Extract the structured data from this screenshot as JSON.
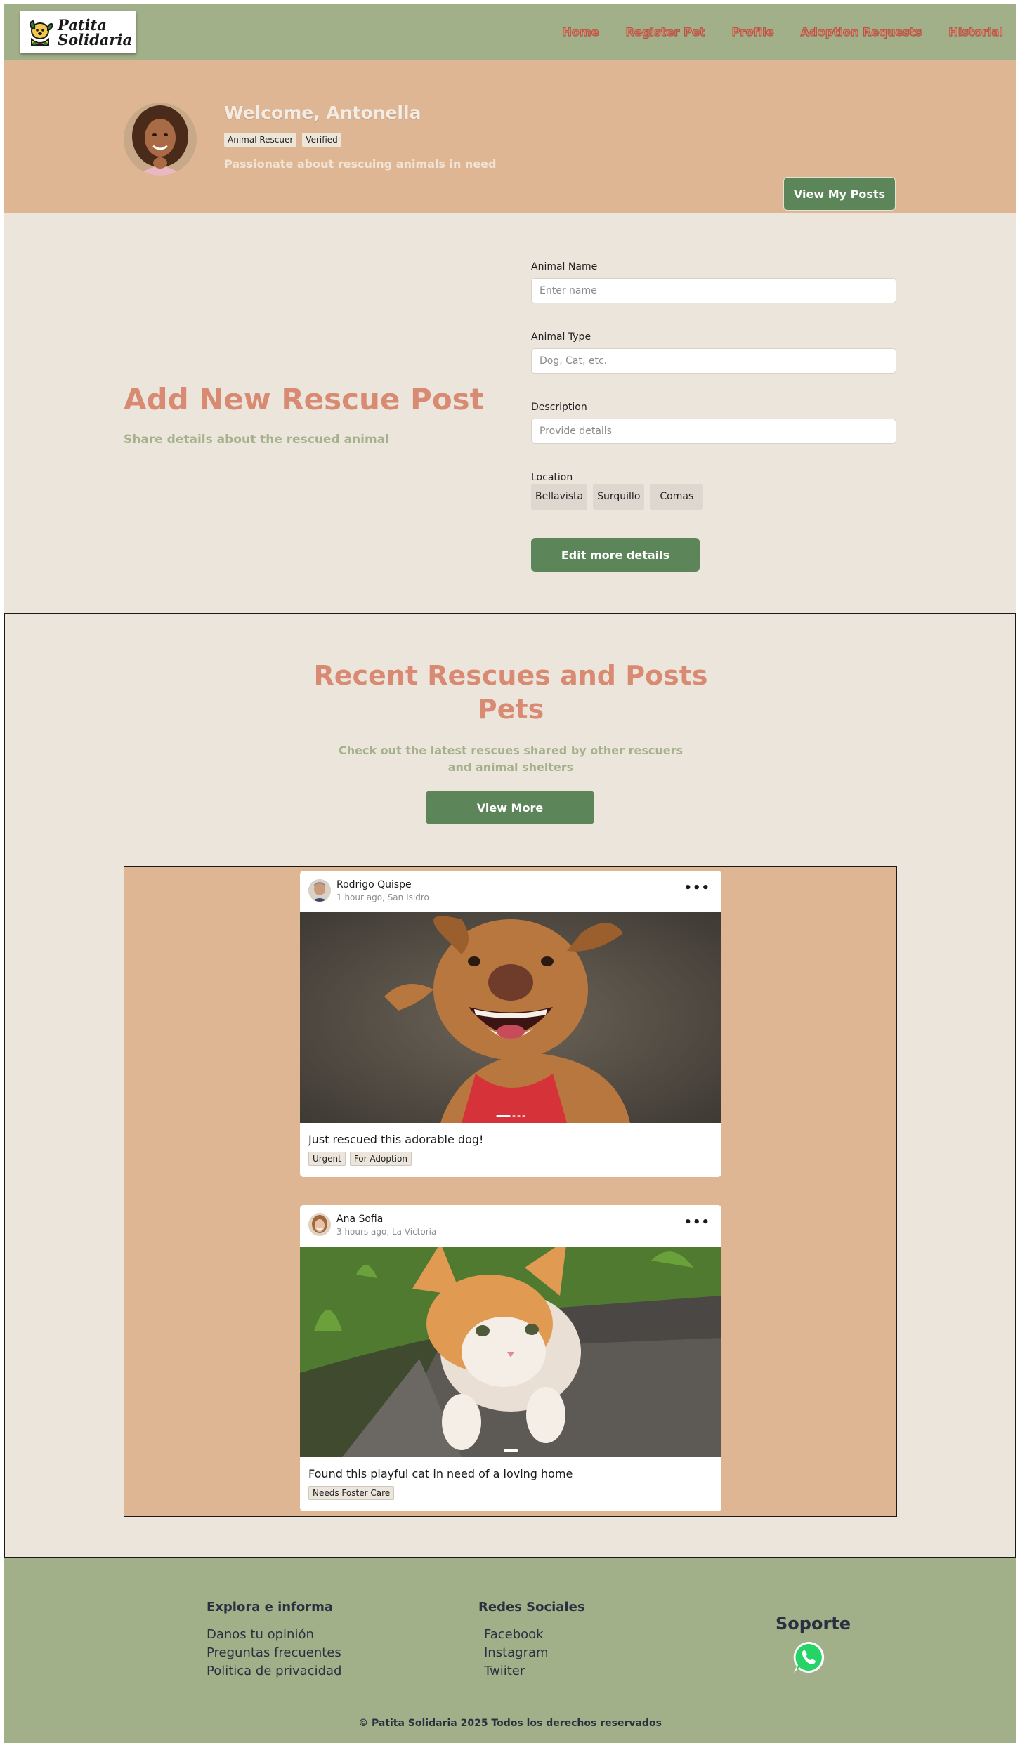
{
  "brand": {
    "name_line1": "Patita",
    "name_line2": "Solidaria"
  },
  "nav": {
    "items": [
      "Home",
      "Register Pet",
      "Profile",
      "Adoption Requests",
      "Historial"
    ]
  },
  "welcome": {
    "title": "Welcome, Antonella",
    "badges": [
      "Animal Rescuer",
      "Verified"
    ],
    "subtitle": "Passionate about rescuing animals in need",
    "button": "View My Posts"
  },
  "add_post": {
    "title": "Add New Rescue Post",
    "subtitle": "Share details about the rescued animal",
    "fields": [
      {
        "label": "Animal Name",
        "placeholder": "Enter name"
      },
      {
        "label": "Animal Type",
        "placeholder": "Dog, Cat, etc."
      },
      {
        "label": "Description",
        "placeholder": "Provide details"
      }
    ],
    "location_label": "Location",
    "locations": [
      "Bellavista",
      "Surquillo",
      "Comas"
    ],
    "button": "Edit more details"
  },
  "recent": {
    "title": "Recent Rescues and Posts Pets",
    "subtitle": "Check out the latest rescues shared by other rescuers and animal shelters",
    "button": "View More"
  },
  "posts": [
    {
      "author": "Rodrigo Quispe",
      "meta": "1 hour ago, San Isidro",
      "caption": "Just rescued this adorable dog!",
      "tags": [
        "Urgent",
        "For Adoption"
      ],
      "image": "dog-photo",
      "slides": 4
    },
    {
      "author": "Ana Sofia",
      "meta": "3 hours ago, La Victoria",
      "caption": "Found this playful cat in need of a loving home",
      "tags": [
        "Needs Foster Care"
      ],
      "image": "kitten-photo",
      "slides": 1
    }
  ],
  "footer": {
    "col1": {
      "heading": "Explora e informa",
      "links": [
        "Danos tu opinión",
        "Preguntas frecuentes",
        "Politica de privacidad"
      ]
    },
    "col2": {
      "heading": "Redes Sociales",
      "links": [
        "Facebook",
        "Instagram",
        "Twiiter"
      ]
    },
    "support": "Soporte",
    "copyright": "© Patita Solidaria 2025 Todos los derechos reservados"
  },
  "colors": {
    "nav_bg": "#a2b08a",
    "welcome_bg": "#dfb694",
    "cream_bg": "#ece5db",
    "accent_coral": "#d98a72",
    "button_green": "#5c8659",
    "whatsapp_green": "#25d366"
  },
  "icons": [
    "dog-logo-icon",
    "whatsapp-icon",
    "more-options-icon"
  ]
}
